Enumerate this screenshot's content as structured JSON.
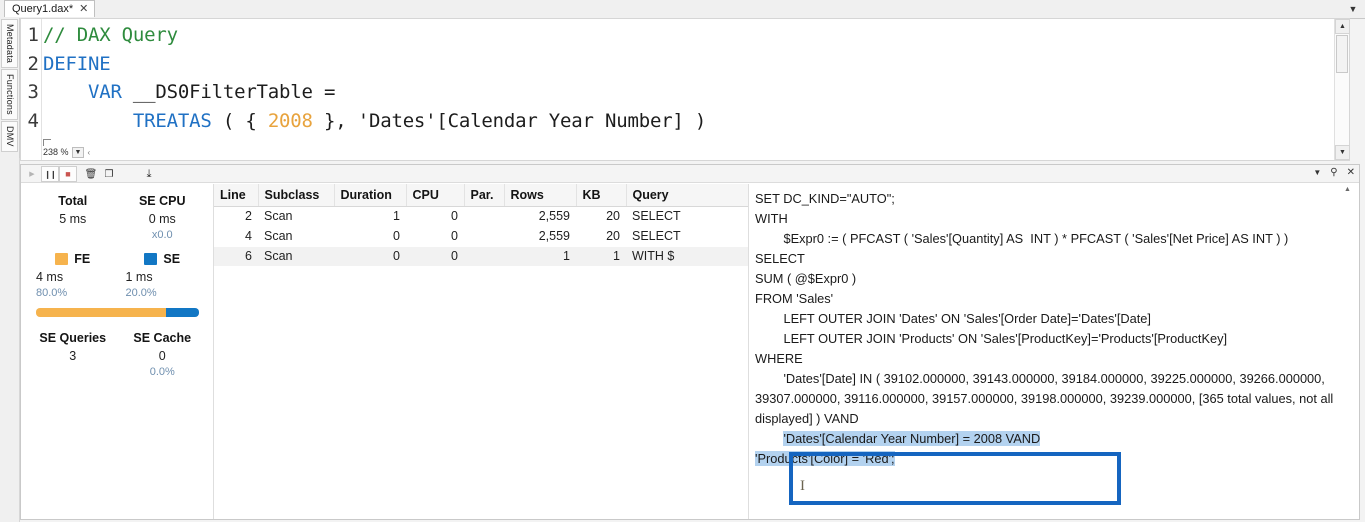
{
  "window": {
    "document_tab": "Query1.dax*",
    "tab_close_glyph": "✕",
    "tabstrip_caret_glyph": "▼"
  },
  "side_dock": {
    "tabs": [
      {
        "label": "Metadata"
      },
      {
        "label": "Functions"
      },
      {
        "label": "DMV"
      }
    ]
  },
  "editor": {
    "zoom_level": "238 %",
    "zoom_caret_glyph": "▼",
    "zoom_tick_glyph": "‹",
    "line_numbers": [
      "1",
      "2",
      "3",
      "4"
    ],
    "lines": [
      {
        "num": "1",
        "tokens": [
          {
            "t": "// DAX Query",
            "c": "cmt"
          }
        ]
      },
      {
        "num": "2",
        "tokens": [
          {
            "t": "DEFINE",
            "c": "kw"
          }
        ]
      },
      {
        "num": "3",
        "tokens": [
          {
            "t": "    ",
            "c": "pl"
          },
          {
            "t": "VAR",
            "c": "kw"
          },
          {
            "t": " __DS0FilterTable =",
            "c": "pl"
          }
        ]
      },
      {
        "num": "4",
        "tokens": [
          {
            "t": "        ",
            "c": "pl"
          },
          {
            "t": "TREATAS",
            "c": "kw"
          },
          {
            "t": " ( { ",
            "c": "pl"
          },
          {
            "t": "2008",
            "c": "num"
          },
          {
            "t": " }, 'Dates'[Calendar Year Number] )",
            "c": "pl"
          }
        ]
      }
    ],
    "scrollbar": {
      "up_glyph": "▲",
      "down_glyph": "▼"
    }
  },
  "timings_panel": {
    "toolbar": [
      {
        "name": "run-button",
        "glyph": "▶",
        "state": "disabled"
      },
      {
        "name": "pause-button",
        "glyph": "❙❙",
        "state": "enabled"
      },
      {
        "name": "stop-button",
        "glyph": "■",
        "state": "active"
      },
      {
        "name": "clear-button",
        "glyph": "🗑",
        "state": "enabled"
      },
      {
        "name": "copy-button",
        "glyph": "❐",
        "state": "enabled"
      },
      {
        "name": "export-button",
        "glyph": "⤓",
        "state": "enabled"
      }
    ],
    "header_controls": [
      {
        "name": "panel-menu-caret",
        "glyph": "▼"
      },
      {
        "name": "panel-pin",
        "glyph": "⚲"
      },
      {
        "name": "panel-close",
        "glyph": "✕"
      }
    ],
    "stats": {
      "total_label": "Total",
      "total_value": "5 ms",
      "se_cpu_label": "SE CPU",
      "se_cpu_value": "0 ms",
      "se_cpu_sub": "x0.0",
      "fe_label": "FE",
      "fe_value": "4 ms",
      "fe_pct": "80.0%",
      "fe_color": "#f6b34d",
      "se_label": "SE",
      "se_value": "1 ms",
      "se_pct": "20.0%",
      "se_color": "#1277c4",
      "bar_fe_pct": 80.0,
      "bar_se_pct": 20.0,
      "se_queries_label": "SE Queries",
      "se_queries_value": "3",
      "se_cache_label": "SE Cache",
      "se_cache_value": "0",
      "se_cache_sub": "0.0%"
    },
    "table": {
      "columns": [
        "Line",
        "Subclass",
        "Duration",
        "CPU",
        "Par.",
        "Rows",
        "KB",
        "Query"
      ],
      "rows": [
        {
          "line": "2",
          "subclass": "Scan",
          "duration": "1",
          "cpu": "0",
          "par": "",
          "rows": "2,559",
          "kb": "20",
          "query": "SELECT"
        },
        {
          "line": "4",
          "subclass": "Scan",
          "duration": "0",
          "cpu": "0",
          "par": "",
          "rows": "2,559",
          "kb": "20",
          "query": "SELECT"
        },
        {
          "line": "6",
          "subclass": "Scan",
          "duration": "0",
          "cpu": "0",
          "par": "",
          "rows": "1",
          "kb": "1",
          "query": "WITH $"
        }
      ],
      "selected_row_index": 2
    },
    "sql_viewer": {
      "scroll_up_glyph": "▲",
      "text_before": "SET DC_KIND=\"AUTO\";\nWITH\n\t$Expr0 := ( PFCAST ( 'Sales'[Quantity] AS  INT ) * PFCAST ( 'Sales'[Net Price] AS INT ) )\nSELECT\nSUM ( @$Expr0 )\nFROM 'Sales'\n\tLEFT OUTER JOIN 'Dates' ON 'Sales'[Order Date]='Dates'[Date]\n\tLEFT OUTER JOIN 'Products' ON 'Sales'[ProductKey]='Products'[ProductKey]\nWHERE\n\t'Dates'[Date] IN ( 39102.000000, 39143.000000, 39184.000000, 39225.000000, 39266.000000, 39307.000000, 39116.000000, 39157.000000, 39198.000000, 39239.000000, [365 total values, not all displayed] ) VAND\n\t",
      "highlight_line_1": "'Dates'[Calendar Year Number] = 2008 VAND",
      "highlight_line_2": "'Products'[Color] = 'Red';",
      "highlight_bg": "#b3d2ef",
      "callout_border_color": "#1565c0",
      "text_cursor_glyph": "I"
    }
  }
}
